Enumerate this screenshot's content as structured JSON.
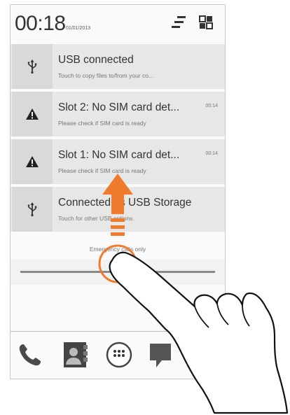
{
  "status_bar": {
    "time": "00:18",
    "date": "01/01/2013",
    "icons": [
      "quick-settings-toggle-icon",
      "grid-settings-icon"
    ]
  },
  "notifications": [
    {
      "icon": "usb-icon",
      "title": "USB connected",
      "subtitle": "Touch to copy files to/from your co...",
      "time": ""
    },
    {
      "icon": "warning-icon",
      "title": "Slot 2: No SIM card det...",
      "subtitle": "Please check if SIM card is ready",
      "time": "00:14"
    },
    {
      "icon": "warning-icon",
      "title": "Slot 1: No SIM card det...",
      "subtitle": "Please check if SIM card is ready",
      "time": "00:14"
    },
    {
      "icon": "usb-icon",
      "title": "Connected as USB Storage",
      "subtitle": "Touch for other USB options.",
      "time": ""
    }
  ],
  "emergency_text": "Emergency calls only",
  "dock": [
    "phone-icon",
    "contacts-icon",
    "app-drawer-icon",
    "messaging-icon"
  ],
  "colors": {
    "arrow": "#f07b2d",
    "notification_bg": "#e7e7e7",
    "icon_box_bg": "#d9d9d9"
  }
}
